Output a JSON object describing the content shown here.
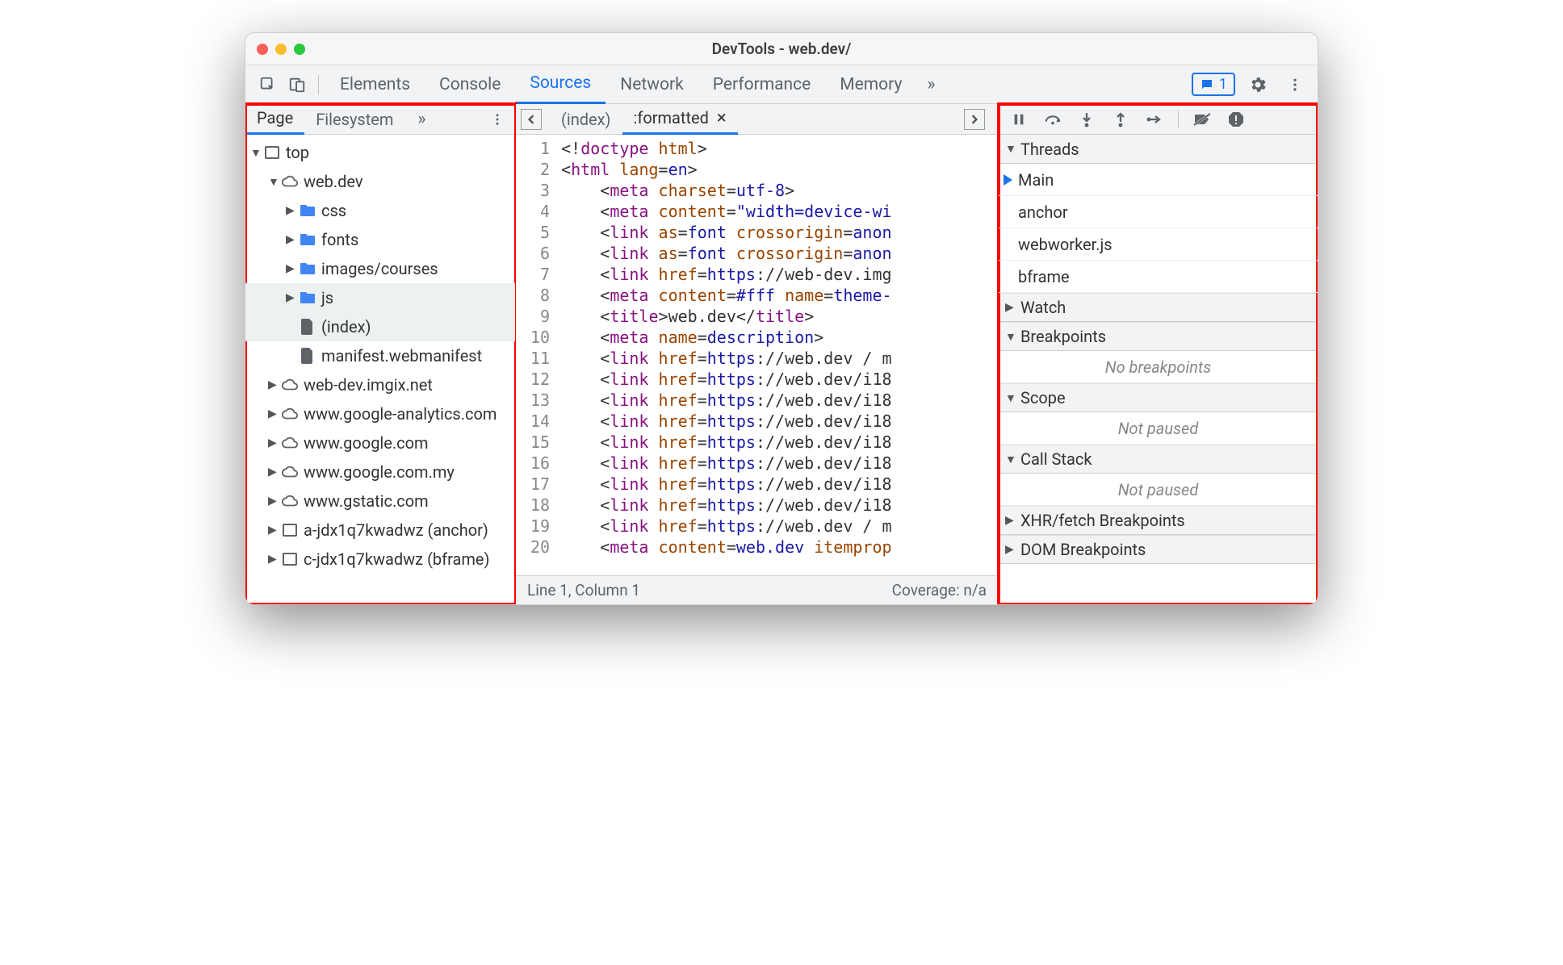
{
  "window": {
    "title": "DevTools - web.dev/"
  },
  "mainTabs": [
    "Elements",
    "Console",
    "Sources",
    "Network",
    "Performance",
    "Memory"
  ],
  "activeMainTab": "Sources",
  "messages": {
    "count": "1"
  },
  "navigator": {
    "tabs": [
      "Page",
      "Filesystem"
    ],
    "tree": [
      {
        "d": 0,
        "exp": "▼",
        "icon": "frame",
        "label": "top"
      },
      {
        "d": 1,
        "exp": "▼",
        "icon": "cloud",
        "label": "web.dev"
      },
      {
        "d": 2,
        "exp": "▶",
        "icon": "folder",
        "label": "css"
      },
      {
        "d": 2,
        "exp": "▶",
        "icon": "folder",
        "label": "fonts"
      },
      {
        "d": 2,
        "exp": "▶",
        "icon": "folder",
        "label": "images/courses"
      },
      {
        "d": 2,
        "exp": "▶",
        "icon": "folder",
        "label": "js",
        "selected": true
      },
      {
        "d": 2,
        "exp": "",
        "icon": "file",
        "label": "(index)",
        "selected": true
      },
      {
        "d": 2,
        "exp": "",
        "icon": "file",
        "label": "manifest.webmanifest"
      },
      {
        "d": 1,
        "exp": "▶",
        "icon": "cloud",
        "label": "web-dev.imgix.net"
      },
      {
        "d": 1,
        "exp": "▶",
        "icon": "cloud",
        "label": "www.google-analytics.com"
      },
      {
        "d": 1,
        "exp": "▶",
        "icon": "cloud",
        "label": "www.google.com"
      },
      {
        "d": 1,
        "exp": "▶",
        "icon": "cloud",
        "label": "www.google.com.my"
      },
      {
        "d": 1,
        "exp": "▶",
        "icon": "cloud",
        "label": "www.gstatic.com"
      },
      {
        "d": 1,
        "exp": "▶",
        "icon": "frame",
        "label": "a-jdx1q7kwadwz (anchor)"
      },
      {
        "d": 1,
        "exp": "▶",
        "icon": "frame",
        "label": "c-jdx1q7kwadwz (bframe)"
      }
    ]
  },
  "editor": {
    "tabs": [
      {
        "label": "(index)",
        "active": false,
        "close": false
      },
      {
        "label": ":formatted",
        "active": true,
        "close": true
      }
    ],
    "lines": [
      [
        [
          "punc",
          "<!"
        ],
        [
          "tag",
          "doctype "
        ],
        [
          "attr",
          "html"
        ],
        [
          "punc",
          ">"
        ]
      ],
      [
        [
          "punc",
          "<"
        ],
        [
          "tag",
          "html "
        ],
        [
          "attr",
          "lang"
        ],
        [
          "punc",
          "="
        ],
        [
          "val",
          "en"
        ],
        [
          "punc",
          ">"
        ]
      ],
      [
        [
          "txt",
          "    "
        ],
        [
          "punc",
          "<"
        ],
        [
          "tag",
          "meta "
        ],
        [
          "attr",
          "charset"
        ],
        [
          "punc",
          "="
        ],
        [
          "val",
          "utf-8"
        ],
        [
          "punc",
          ">"
        ]
      ],
      [
        [
          "txt",
          "    "
        ],
        [
          "punc",
          "<"
        ],
        [
          "tag",
          "meta "
        ],
        [
          "attr",
          "content"
        ],
        [
          "punc",
          "="
        ],
        [
          "str",
          "\"width=device-wi"
        ]
      ],
      [
        [
          "txt",
          "    "
        ],
        [
          "punc",
          "<"
        ],
        [
          "tag",
          "link "
        ],
        [
          "attr",
          "as"
        ],
        [
          "punc",
          "="
        ],
        [
          "val",
          "font "
        ],
        [
          "attr",
          "crossorigin"
        ],
        [
          "punc",
          "="
        ],
        [
          "val",
          "anon"
        ]
      ],
      [
        [
          "txt",
          "    "
        ],
        [
          "punc",
          "<"
        ],
        [
          "tag",
          "link "
        ],
        [
          "attr",
          "as"
        ],
        [
          "punc",
          "="
        ],
        [
          "val",
          "font "
        ],
        [
          "attr",
          "crossorigin"
        ],
        [
          "punc",
          "="
        ],
        [
          "val",
          "anon"
        ]
      ],
      [
        [
          "txt",
          "    "
        ],
        [
          "punc",
          "<"
        ],
        [
          "tag",
          "link "
        ],
        [
          "attr",
          "href"
        ],
        [
          "punc",
          "="
        ],
        [
          "val",
          "https"
        ],
        [
          "txt",
          "://web-dev.img"
        ]
      ],
      [
        [
          "txt",
          "    "
        ],
        [
          "punc",
          "<"
        ],
        [
          "tag",
          "meta "
        ],
        [
          "attr",
          "content"
        ],
        [
          "punc",
          "="
        ],
        [
          "val",
          "#fff "
        ],
        [
          "attr",
          "name"
        ],
        [
          "punc",
          "="
        ],
        [
          "val",
          "theme-"
        ]
      ],
      [
        [
          "txt",
          "    "
        ],
        [
          "punc",
          "<"
        ],
        [
          "tag",
          "title"
        ],
        [
          "punc",
          ">"
        ],
        [
          "txt",
          "web.dev"
        ],
        [
          "punc",
          "</"
        ],
        [
          "tag",
          "title"
        ],
        [
          "punc",
          ">"
        ]
      ],
      [
        [
          "txt",
          "    "
        ],
        [
          "punc",
          "<"
        ],
        [
          "tag",
          "meta "
        ],
        [
          "attr",
          "name"
        ],
        [
          "punc",
          "="
        ],
        [
          "val",
          "description"
        ],
        [
          "punc",
          ">"
        ]
      ],
      [
        [
          "txt",
          "    "
        ],
        [
          "punc",
          "<"
        ],
        [
          "tag",
          "link "
        ],
        [
          "attr",
          "href"
        ],
        [
          "punc",
          "="
        ],
        [
          "val",
          "https"
        ],
        [
          "txt",
          "://web.dev / m"
        ]
      ],
      [
        [
          "txt",
          "    "
        ],
        [
          "punc",
          "<"
        ],
        [
          "tag",
          "link "
        ],
        [
          "attr",
          "href"
        ],
        [
          "punc",
          "="
        ],
        [
          "val",
          "https"
        ],
        [
          "txt",
          "://web.dev/i18"
        ]
      ],
      [
        [
          "txt",
          "    "
        ],
        [
          "punc",
          "<"
        ],
        [
          "tag",
          "link "
        ],
        [
          "attr",
          "href"
        ],
        [
          "punc",
          "="
        ],
        [
          "val",
          "https"
        ],
        [
          "txt",
          "://web.dev/i18"
        ]
      ],
      [
        [
          "txt",
          "    "
        ],
        [
          "punc",
          "<"
        ],
        [
          "tag",
          "link "
        ],
        [
          "attr",
          "href"
        ],
        [
          "punc",
          "="
        ],
        [
          "val",
          "https"
        ],
        [
          "txt",
          "://web.dev/i18"
        ]
      ],
      [
        [
          "txt",
          "    "
        ],
        [
          "punc",
          "<"
        ],
        [
          "tag",
          "link "
        ],
        [
          "attr",
          "href"
        ],
        [
          "punc",
          "="
        ],
        [
          "val",
          "https"
        ],
        [
          "txt",
          "://web.dev/i18"
        ]
      ],
      [
        [
          "txt",
          "    "
        ],
        [
          "punc",
          "<"
        ],
        [
          "tag",
          "link "
        ],
        [
          "attr",
          "href"
        ],
        [
          "punc",
          "="
        ],
        [
          "val",
          "https"
        ],
        [
          "txt",
          "://web.dev/i18"
        ]
      ],
      [
        [
          "txt",
          "    "
        ],
        [
          "punc",
          "<"
        ],
        [
          "tag",
          "link "
        ],
        [
          "attr",
          "href"
        ],
        [
          "punc",
          "="
        ],
        [
          "val",
          "https"
        ],
        [
          "txt",
          "://web.dev/i18"
        ]
      ],
      [
        [
          "txt",
          "    "
        ],
        [
          "punc",
          "<"
        ],
        [
          "tag",
          "link "
        ],
        [
          "attr",
          "href"
        ],
        [
          "punc",
          "="
        ],
        [
          "val",
          "https"
        ],
        [
          "txt",
          "://web.dev/i18"
        ]
      ],
      [
        [
          "txt",
          "    "
        ],
        [
          "punc",
          "<"
        ],
        [
          "tag",
          "link "
        ],
        [
          "attr",
          "href"
        ],
        [
          "punc",
          "="
        ],
        [
          "val",
          "https"
        ],
        [
          "txt",
          "://web.dev / m"
        ]
      ],
      [
        [
          "txt",
          "    "
        ],
        [
          "punc",
          "<"
        ],
        [
          "tag",
          "meta "
        ],
        [
          "attr",
          "content"
        ],
        [
          "punc",
          "="
        ],
        [
          "val",
          "web.dev "
        ],
        [
          "attr",
          "itemprop"
        ]
      ]
    ],
    "status": {
      "pos": "Line 1, Column 1",
      "coverage": "Coverage: n/a"
    }
  },
  "debugger": {
    "sections": [
      {
        "name": "Threads",
        "expanded": true,
        "items": [
          "Main",
          "anchor",
          "webworker.js",
          "bframe"
        ],
        "current": "Main"
      },
      {
        "name": "Watch",
        "expanded": false
      },
      {
        "name": "Breakpoints",
        "expanded": true,
        "empty": "No breakpoints"
      },
      {
        "name": "Scope",
        "expanded": true,
        "empty": "Not paused"
      },
      {
        "name": "Call Stack",
        "expanded": true,
        "empty": "Not paused"
      },
      {
        "name": "XHR/fetch Breakpoints",
        "expanded": false
      },
      {
        "name": "DOM Breakpoints",
        "expanded": false
      }
    ]
  }
}
